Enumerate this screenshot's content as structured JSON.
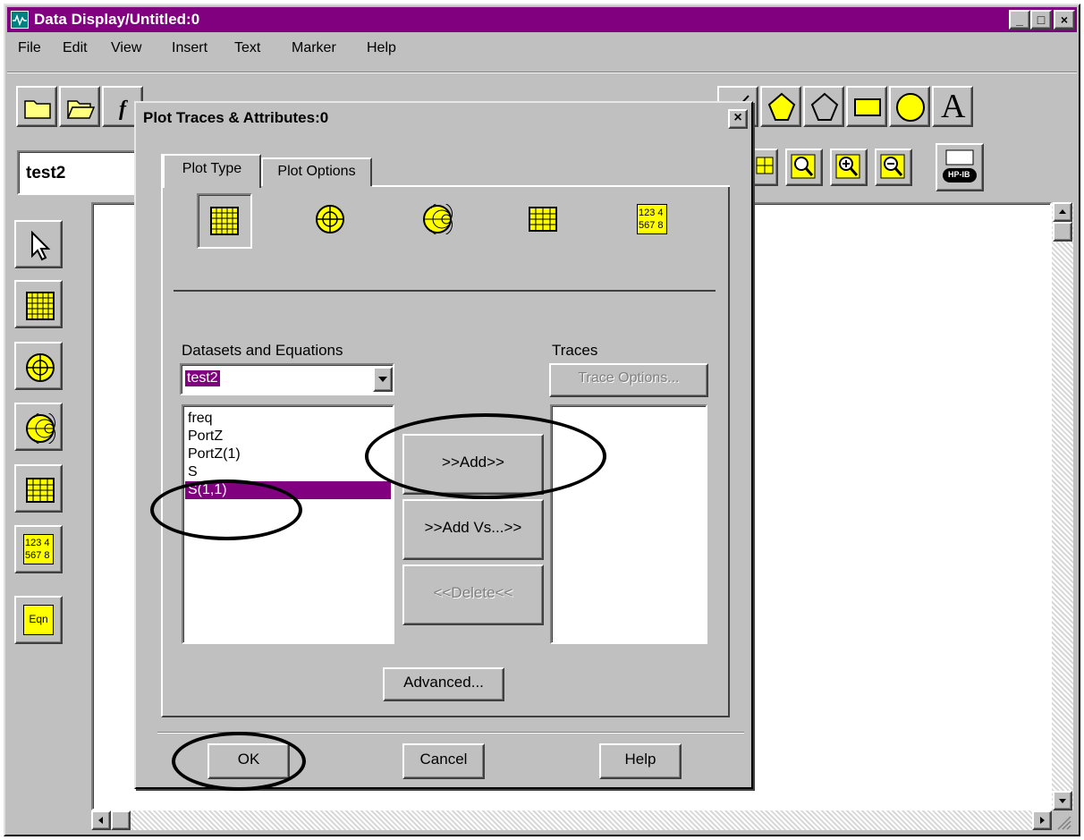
{
  "window": {
    "title": "Data Display/Untitled:0",
    "controls": [
      "_",
      "□",
      "×"
    ]
  },
  "menu": [
    "File",
    "Edit",
    "View",
    "Insert",
    "Text",
    "Marker",
    "Help"
  ],
  "toolbar": {
    "dataset_combo_value": "test2"
  },
  "dialog": {
    "title": "Plot Traces & Attributes:0",
    "close": "×",
    "tabs": [
      "Plot Type",
      "Plot Options"
    ],
    "datasets_label": "Datasets and Equations",
    "dataset_selected": "test2",
    "list_items": [
      "freq",
      "PortZ",
      "PortZ(1)",
      "S",
      "S(1,1)"
    ],
    "selected_item": "S(1,1)",
    "traces_label": "Traces",
    "trace_options": "Trace Options...",
    "add": ">>Add>>",
    "add_vs": ">>Add Vs...>>",
    "delete": "<<Delete<<",
    "advanced": "Advanced...",
    "ok": "OK",
    "cancel": "Cancel",
    "help": "Help"
  },
  "icon_text": {
    "numeric_label_top": "123 4",
    "numeric_label_bottom": "567 8",
    "eqn": "Eqn",
    "text_tool": "A",
    "hpib": "HP-IB"
  },
  "colors": {
    "title_bar": "#800080",
    "selection": "#800080",
    "icon_fill": "#ffff00",
    "chrome": "#c0c0c0"
  }
}
